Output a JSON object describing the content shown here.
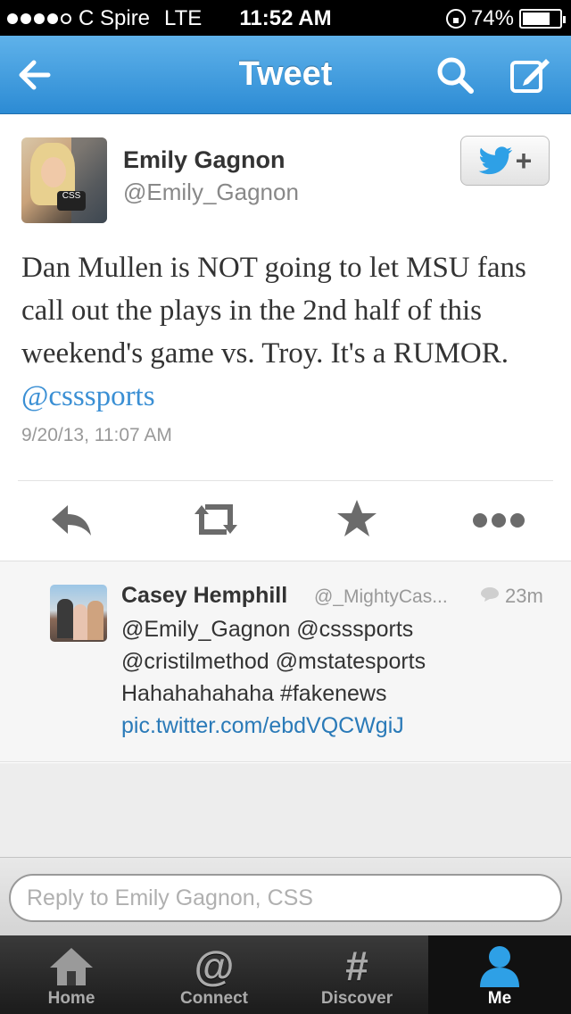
{
  "status_bar": {
    "carrier": "C Spire",
    "network": "LTE",
    "time": "11:52 AM",
    "battery": "74%",
    "battery_level": 0.74,
    "signal_bars": 4
  },
  "nav": {
    "title": "Tweet",
    "back_icon": "back-arrow-icon",
    "search_icon": "search-icon",
    "compose_icon": "compose-icon"
  },
  "tweet": {
    "author_name": "Emily Gagnon",
    "author_handle": "@Emily_Gagnon",
    "text": "Dan Mullen is NOT going to let MSU fans call out the plays in the 2nd half of this weekend's game vs. Troy. It's a RUMOR. ",
    "mention": "@csssports",
    "timestamp": "9/20/13, 11:07 AM",
    "avatar_caption": "CSS",
    "follow_icon": "twitter-bird-plus-icon",
    "follow_symbol": "+"
  },
  "actions": [
    "reply-icon",
    "retweet-icon",
    "favorite-icon",
    "more-icon"
  ],
  "reply": {
    "author_name": "Casey Hemphill",
    "author_handle": "@_MightyCas...",
    "age": "23m",
    "lines": [
      "@Emily_Gagnon @csssports",
      "@cristilmethod @mstatesports",
      "Hahahahahaha #fakenews"
    ],
    "link": "pic.twitter.com/ebdVQCWgiJ"
  },
  "reply_input": {
    "placeholder": "Reply to Emily Gagnon, CSS"
  },
  "tabs": [
    {
      "label": "Home",
      "icon": "home-icon",
      "active": false
    },
    {
      "label": "Connect",
      "icon": "at-sign-icon",
      "glyph": "@",
      "active": false
    },
    {
      "label": "Discover",
      "icon": "hashtag-icon",
      "glyph": "#",
      "active": false
    },
    {
      "label": "Me",
      "icon": "person-icon",
      "active": true
    }
  ],
  "colors": {
    "nav_top": "#5fb2ea",
    "nav_bottom": "#2c8bd4",
    "link": "#3a8fd4",
    "me_tab": "#2ea0e6"
  }
}
